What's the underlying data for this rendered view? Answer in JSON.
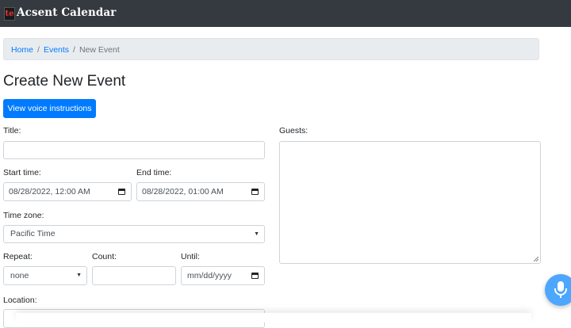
{
  "navbar": {
    "logo_glyph": "te",
    "brand": "Acsent Calendar"
  },
  "breadcrumb": {
    "home": "Home",
    "sep1": "/",
    "events": "Events",
    "sep2": "/",
    "current": "New Event"
  },
  "page": {
    "title": "Create New Event",
    "voice_button": "View voice instructions"
  },
  "form": {
    "title_label": "Title:",
    "title_value": "",
    "start_label": "Start time:",
    "start_value": "08/28/2022, 12:00 AM",
    "end_label": "End time:",
    "end_value": "08/28/2022, 01:00 AM",
    "timezone_label": "Time zone:",
    "timezone_value": "Pacific Time",
    "repeat_label": "Repeat:",
    "repeat_value": "none",
    "count_label": "Count:",
    "count_value": "",
    "until_label": "Until:",
    "until_value": "mm/dd/yyyy",
    "location_label": "Location:",
    "location_value": "",
    "guests_label": "Guests:",
    "guests_value": ""
  },
  "icons": {
    "calendar": "calendar-icon",
    "caret": "chevron-down-icon",
    "mic": "microphone-icon"
  },
  "colors": {
    "navbar": "#343a40",
    "primary": "#007bff",
    "mic_button": "#4da6ff"
  }
}
